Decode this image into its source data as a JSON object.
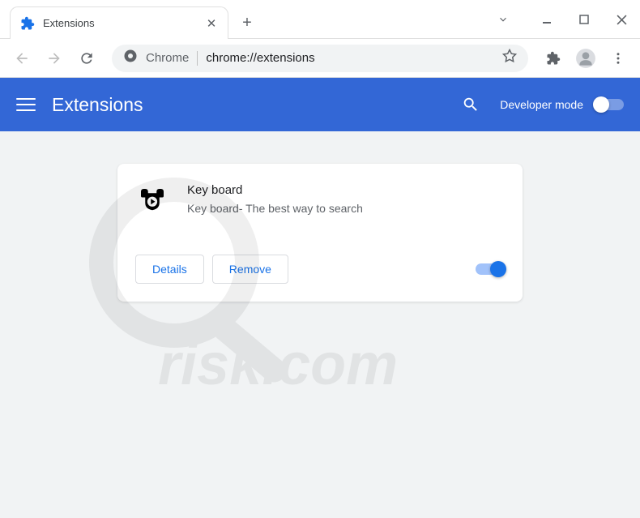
{
  "titlebar": {
    "tab_title": "Extensions"
  },
  "addressbar": {
    "prefix": "Chrome",
    "url": "chrome://extensions"
  },
  "header": {
    "title": "Extensions",
    "dev_mode_label": "Developer mode"
  },
  "extension": {
    "name": "Key board",
    "description": "Key board- The best way to search",
    "details_label": "Details",
    "remove_label": "Remove"
  }
}
